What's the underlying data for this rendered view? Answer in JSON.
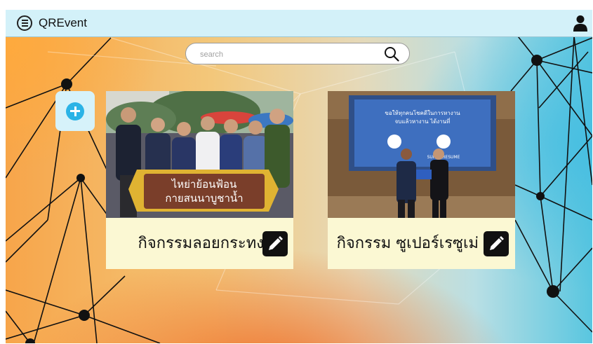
{
  "app": {
    "title": "QREvent"
  },
  "search": {
    "placeholder": "search",
    "value": ""
  },
  "events": [
    {
      "title": "กิจกรรมลอยกระทง",
      "sign_line1": "ไหย่าย้อนฟ้อน",
      "sign_line2": "กายสนนาบูชาน้ำ"
    },
    {
      "title": "กิจกรรม ซูเปอร์เรซูเม่",
      "screen_line1": "ขอให้ทุกคนโชคดีในการหางาน",
      "screen_line2": "จบแล้วหางาน ได้งานที่",
      "brand_right": "SUPER RESUME"
    }
  ],
  "icons": {
    "menu": "hamburger-circle-icon",
    "user": "user-icon",
    "search": "magnifier-icon",
    "add": "plus-circle-icon",
    "edit": "pencil-icon"
  },
  "colors": {
    "topbar": "#d3f1f9",
    "card": "#fbf8d3",
    "accent": "#2bb3e6",
    "edit_button": "#111111"
  }
}
